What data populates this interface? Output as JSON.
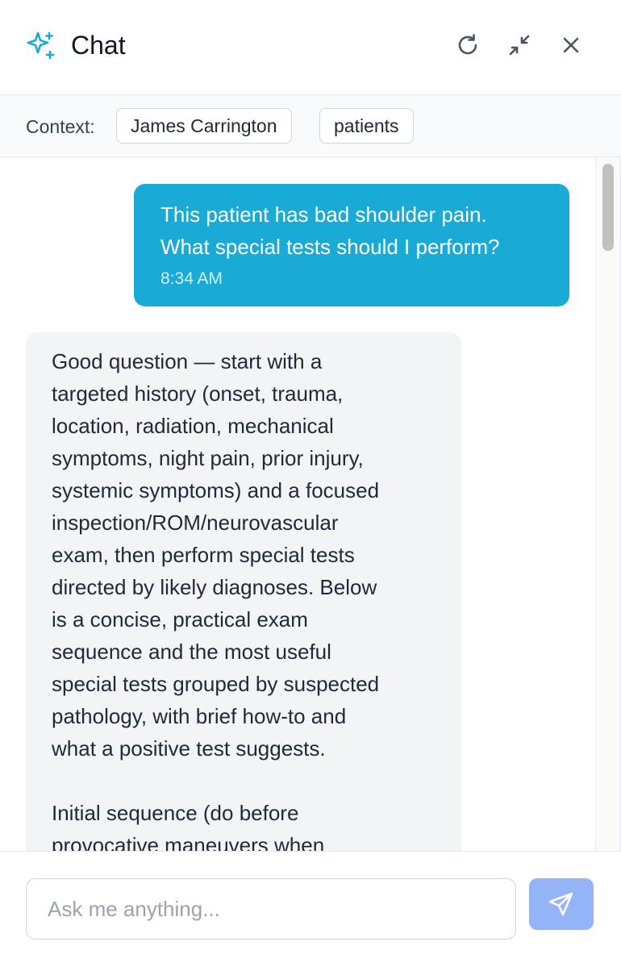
{
  "header": {
    "title": "Chat",
    "icons": {
      "logo": "sparkles-icon",
      "refresh": "refresh-icon",
      "minimize": "minimize-icon",
      "close": "close-icon"
    },
    "accent_color": "#1aaad6"
  },
  "context": {
    "label": "Context:",
    "chips": [
      "James Carrington",
      "patients"
    ]
  },
  "messages": [
    {
      "role": "user",
      "text": "This patient has bad shoulder pain.\nWhat special tests should I perform?",
      "time": "8:34 AM"
    },
    {
      "role": "assistant",
      "text": "Good question — start with a\ntargeted history (onset, trauma,\nlocation, radiation, mechanical\nsymptoms, night pain, prior injury,\nsystemic symptoms) and a focused\ninspection/ROM/neurovascular\nexam, then perform special tests\ndirected by likely diagnoses. Below\nis a concise, practical exam\nsequence and the most useful\nspecial tests grouped by suspected\npathology, with brief how-to and\nwhat a positive test suggests.\n\nInitial sequence (do before\nprovocative maneuvers when"
    }
  ],
  "composer": {
    "placeholder": "Ask me anything...",
    "value": "",
    "send_icon": "send-icon",
    "send_color": "#93b4f6"
  }
}
